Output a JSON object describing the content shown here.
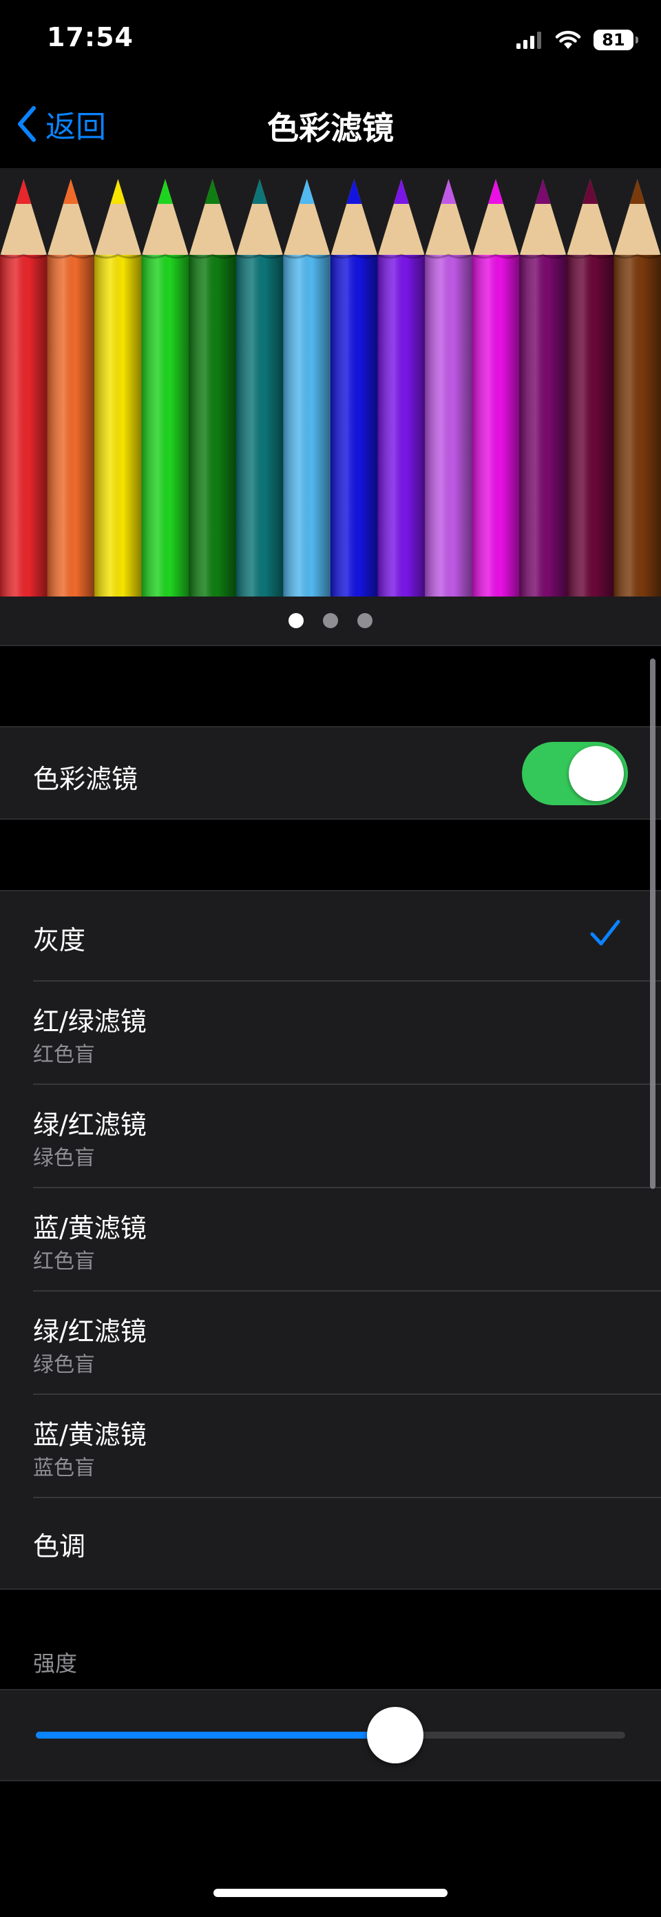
{
  "status_bar": {
    "time": "17:54",
    "battery": "81",
    "icons": [
      "cellular-signal-icon",
      "wifi-icon",
      "battery-icon"
    ]
  },
  "nav": {
    "back_label": "返回",
    "title": "色彩滤镜"
  },
  "pencils": {
    "colors": [
      "#e8262b",
      "#f06a2a",
      "#f7e400",
      "#1fd41f",
      "#0f7d12",
      "#0d7577",
      "#52b8f0",
      "#1414e0",
      "#7a16e8",
      "#c05ae6",
      "#ea10e6",
      "#7a0a6e",
      "#6a0838",
      "#7a3a0c"
    ]
  },
  "pager": {
    "count": 3,
    "active_index": 0
  },
  "toggle_row": {
    "label": "色彩滤镜",
    "enabled": true
  },
  "filters": [
    {
      "title": "灰度",
      "subtitle": "",
      "selected": true
    },
    {
      "title": "红/绿滤镜",
      "subtitle": "红色盲",
      "selected": false
    },
    {
      "title": "绿/红滤镜",
      "subtitle": "绿色盲",
      "selected": false
    },
    {
      "title": "蓝/黄滤镜",
      "subtitle": "红色盲",
      "selected": false
    },
    {
      "title": "绿/红滤镜",
      "subtitle": "绿色盲",
      "selected": false
    },
    {
      "title": "蓝/黄滤镜",
      "subtitle": "蓝色盲",
      "selected": false
    },
    {
      "title": "色调",
      "subtitle": "",
      "selected": false
    }
  ],
  "intensity": {
    "header": "强度",
    "value": 0.61
  },
  "colors": {
    "accent": "#0a84ff",
    "toggle_on": "#34c759",
    "cell_bg": "#1c1c1e"
  }
}
